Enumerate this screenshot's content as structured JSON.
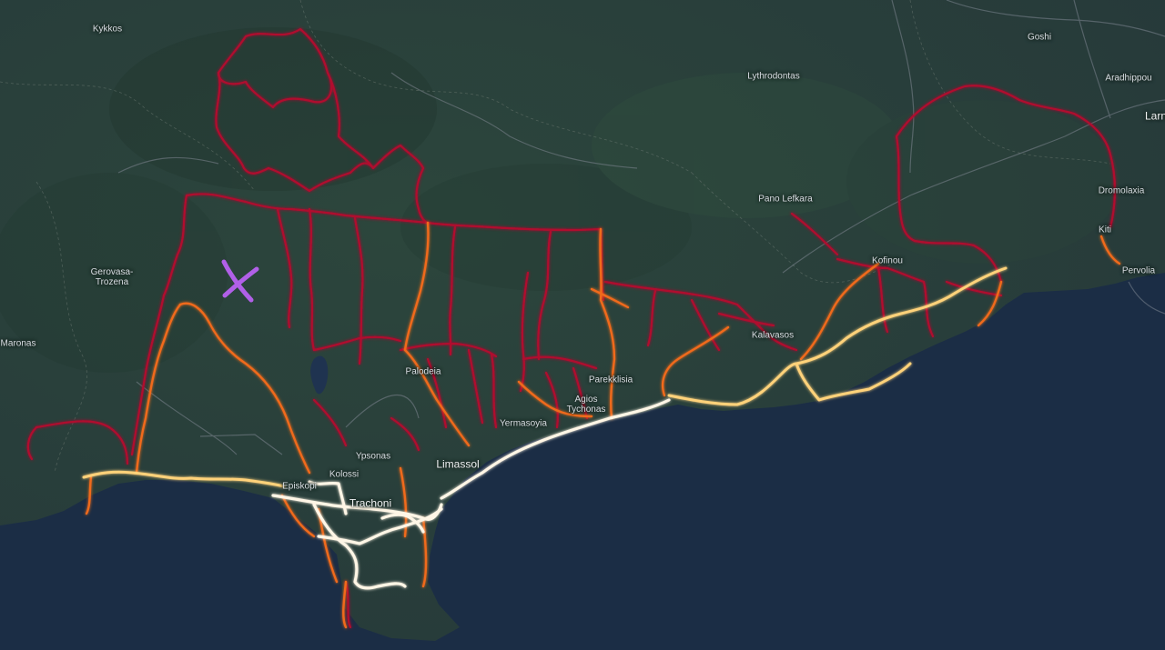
{
  "map": {
    "places": [
      {
        "id": "kykkos",
        "name": "Kykkos"
      },
      {
        "id": "goshi",
        "name": "Goshi"
      },
      {
        "id": "lythrodontas",
        "name": "Lythrodontas"
      },
      {
        "id": "aradhippou",
        "name": "Aradhippou"
      },
      {
        "id": "larnaca",
        "name": "Larn"
      },
      {
        "id": "pano-lefkara",
        "name": "Pano Lefkara"
      },
      {
        "id": "dromolaxia",
        "name": "Dromolaxia"
      },
      {
        "id": "kiti",
        "name": "Kiti"
      },
      {
        "id": "kofinou",
        "name": "Kofinou"
      },
      {
        "id": "pervolia",
        "name": "Pervolia"
      },
      {
        "id": "gerovasa",
        "name": "Gerovasa-\nTrozena"
      },
      {
        "id": "maronas",
        "name": "Maronas"
      },
      {
        "id": "kalavasos",
        "name": "Kalavasos"
      },
      {
        "id": "palodeia",
        "name": "Palodeia"
      },
      {
        "id": "parekklisia",
        "name": "Parekklisia"
      },
      {
        "id": "agios-tychonas",
        "name": "Agios\nTychonas"
      },
      {
        "id": "yermasoyia",
        "name": "Yermasoyia"
      },
      {
        "id": "ypsonas",
        "name": "Ypsonas"
      },
      {
        "id": "limassol",
        "name": "Limassol"
      },
      {
        "id": "kolossi",
        "name": "Kolossi"
      },
      {
        "id": "episkopi",
        "name": "Episkopi"
      },
      {
        "id": "trachoni",
        "name": "Trachoni"
      }
    ],
    "colors": {
      "land": "#2a4239",
      "sea": "#1b2d45",
      "heat_low": "#b0102e",
      "heat_mid": "#f06a1a",
      "heat_high": "#ffd27a",
      "heat_peak": "#fff6e6",
      "marker": "#b160e8"
    },
    "marker_icon": "x-mark-icon"
  }
}
